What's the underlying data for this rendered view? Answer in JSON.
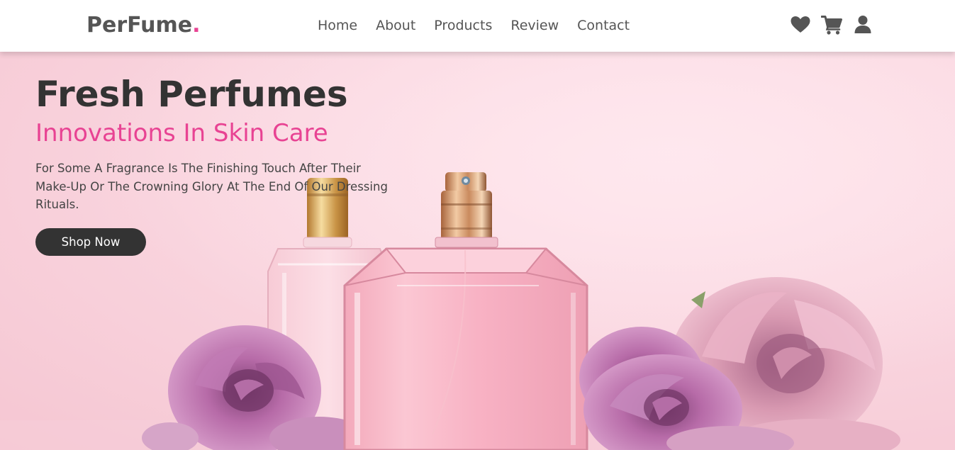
{
  "header": {
    "logo_text": "PerFume",
    "logo_dot": ".",
    "nav": [
      "Home",
      "About",
      "Products",
      "Review",
      "Contact"
    ],
    "icons": [
      "heart-icon",
      "shopping-cart-icon",
      "user-icon"
    ]
  },
  "hero": {
    "title": "Fresh Perfumes",
    "subtitle": "Innovations In Skin Care",
    "description": "For Some A Fragrance Is The Finishing Touch After Their Make-Up Or The Crowning Glory At The End Of Our Dressing Rituals.",
    "button_label": "Shop Now"
  },
  "colors": {
    "accent": "#e84393",
    "dark": "#333333",
    "text": "#555555",
    "hero_background": "#fad4de"
  }
}
